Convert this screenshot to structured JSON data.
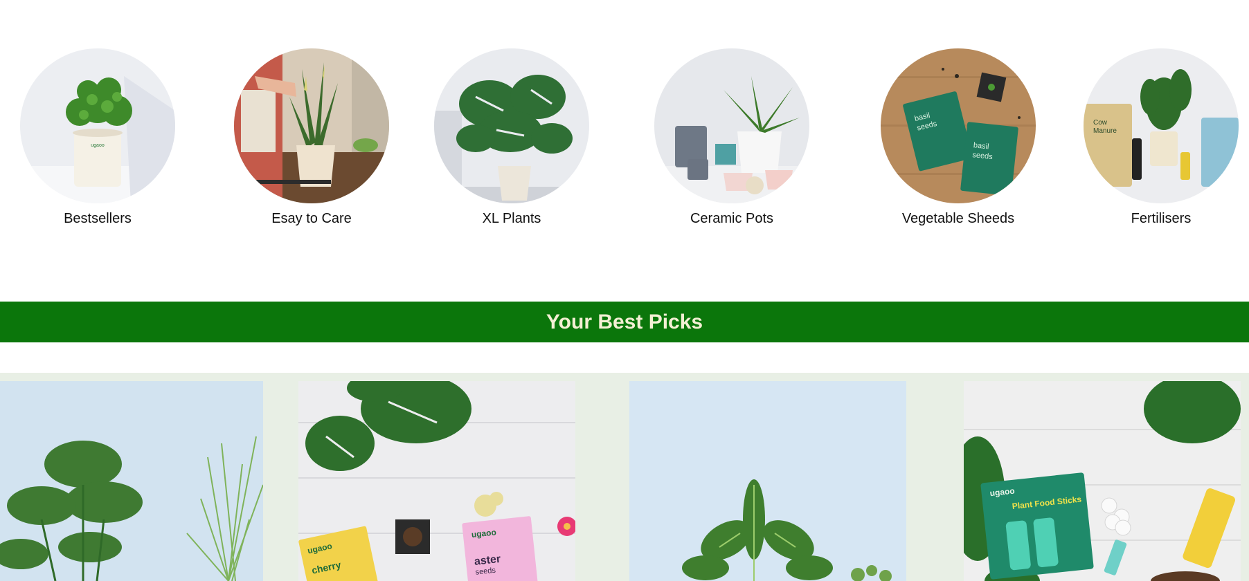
{
  "categories": [
    {
      "label": "Bestsellers",
      "icon": "potted-plant-image"
    },
    {
      "label": "Esay to Care",
      "icon": "snake-plant-image"
    },
    {
      "label": "XL Plants",
      "icon": "monstera-image"
    },
    {
      "label": "Ceramic Pots",
      "icon": "ceramic-pots-image"
    },
    {
      "label": "Vegetable Sheeds",
      "icon": "seed-packets-image"
    },
    {
      "label": "Fertilisers",
      "icon": "fertiliser-products-image"
    }
  ],
  "banner": {
    "title": "Your Best Picks"
  },
  "picks": [
    {
      "icon": "monstera-areca-image"
    },
    {
      "icon": "seed-kit-image",
      "packet1_brand": "ugaoo",
      "packet1_text": "cherry",
      "packet2_brand": "ugaoo",
      "packet2_text": "aster",
      "packet2_sub": "seeds"
    },
    {
      "icon": "calathea-image"
    },
    {
      "icon": "plant-food-sticks-image",
      "brand": "ugaoo",
      "text": "Plant Food Sticks"
    }
  ],
  "colors": {
    "banner_bg": "#0b760b",
    "banner_text": "#f4f0d4",
    "strip_bg": "#e8efe5"
  }
}
